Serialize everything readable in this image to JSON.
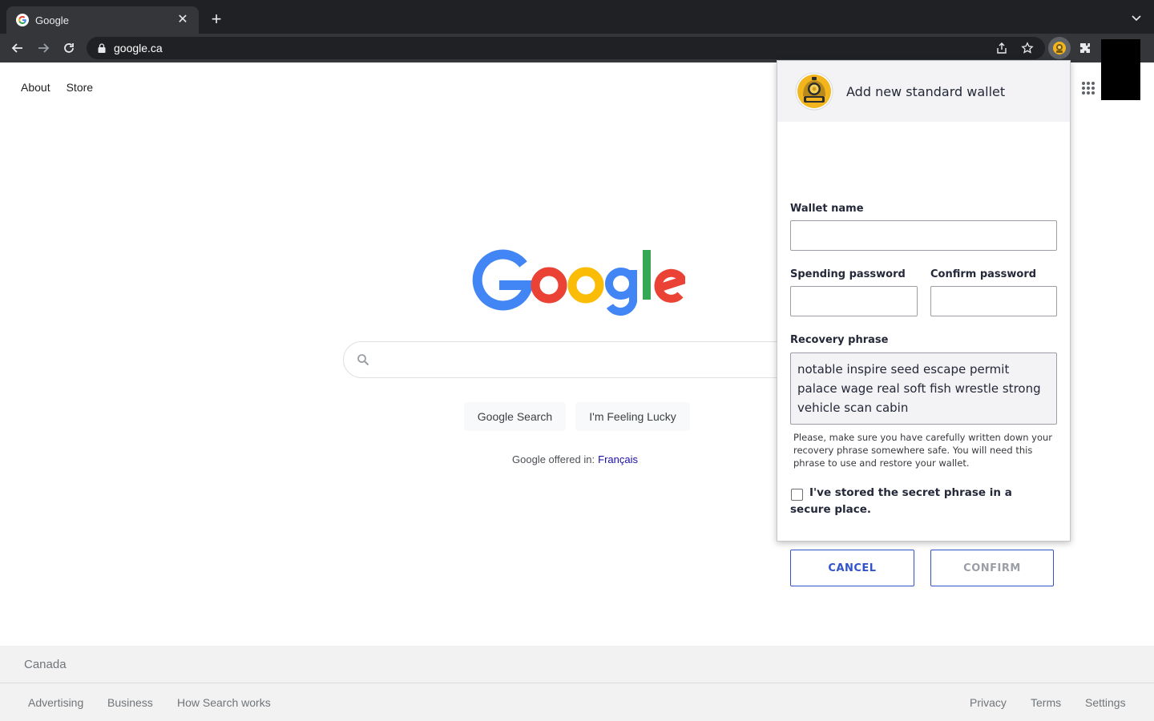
{
  "browser": {
    "tab_title": "Google",
    "url": "google.ca"
  },
  "google": {
    "top_links": [
      "About",
      "Store"
    ],
    "search_button": "Google Search",
    "lucky_button": "I'm Feeling Lucky",
    "offered_in": "Google offered in:",
    "offered_language": "Français",
    "footer_country": "Canada",
    "footer_left": [
      "Advertising",
      "Business",
      "How Search works"
    ],
    "footer_right": [
      "Privacy",
      "Terms",
      "Settings"
    ]
  },
  "wallet_popup": {
    "title": "Add new standard wallet",
    "wallet_name_label": "Wallet name",
    "wallet_name_value": "",
    "spending_password_label": "Spending password",
    "confirm_password_label": "Confirm password",
    "recovery_phrase_label": "Recovery phrase",
    "recovery_phrase": "notable inspire seed escape permit palace wage real soft fish wrestle strong vehicle scan cabin",
    "phrase_note": "Please, make sure you have carefully written down your recovery phrase somewhere safe. You will need this phrase to use and restore your wallet.",
    "stored_checkbox_label": "I've stored the secret phrase in a secure place.",
    "stored_checked": false,
    "cancel_label": "CANCEL",
    "confirm_label": "CONFIRM"
  },
  "colors": {
    "chrome_dark": "#202124",
    "chrome_toolbar": "#35363a",
    "popup_accent": "#3154cb",
    "google_blue": "#4285F4",
    "google_red": "#EA4335",
    "google_yellow": "#FBBC05",
    "google_green": "#34A853"
  },
  "icons": [
    "google-favicon",
    "close-icon",
    "plus-icon",
    "chevron-down-icon",
    "back-arrow-icon",
    "forward-arrow-icon",
    "reload-icon",
    "lock-icon",
    "share-icon",
    "star-icon",
    "wallet-extension-icon",
    "puzzle-icon",
    "apps-grid-icon",
    "search-icon",
    "diver-helmet-logo"
  ]
}
